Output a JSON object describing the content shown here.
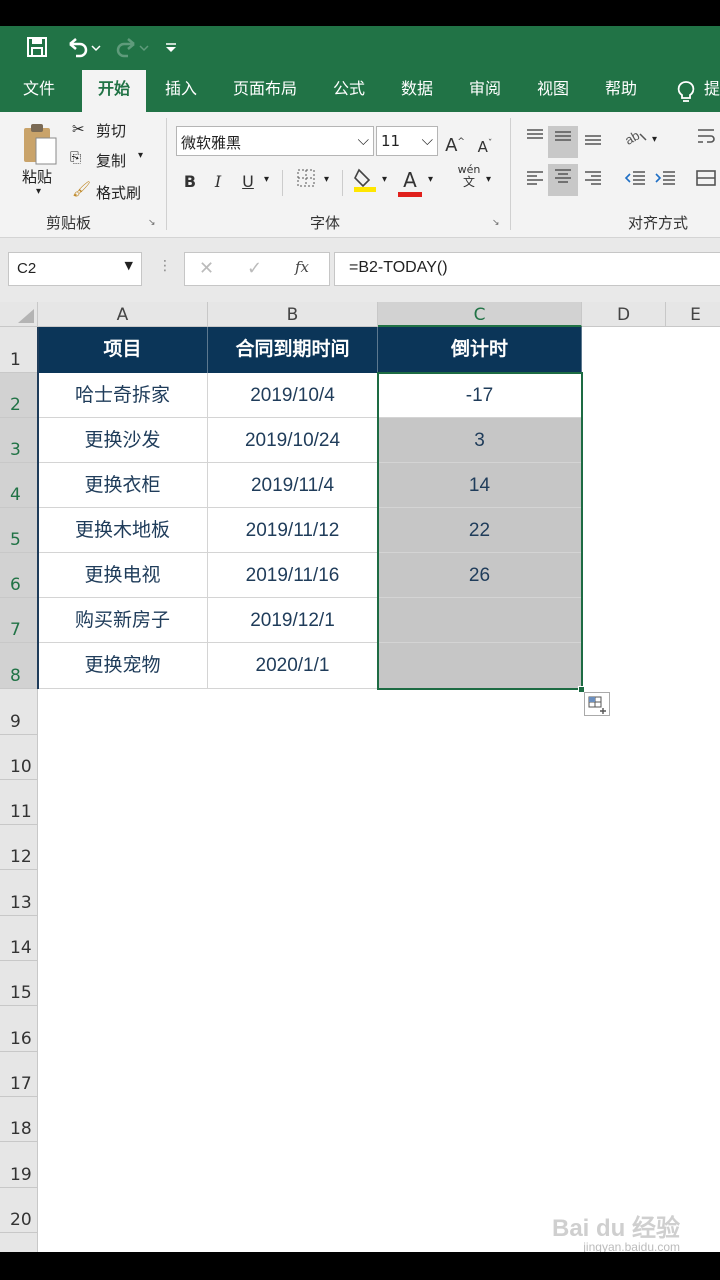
{
  "qat": {
    "save_icon": "save-icon",
    "undo_icon": "undo-icon",
    "redo_icon": "redo-icon",
    "customize_icon": "customize-icon"
  },
  "tabs": [
    {
      "label": "文件"
    },
    {
      "label": "开始"
    },
    {
      "label": "插入"
    },
    {
      "label": "页面布局"
    },
    {
      "label": "公式"
    },
    {
      "label": "数据"
    },
    {
      "label": "审阅"
    },
    {
      "label": "视图"
    },
    {
      "label": "帮助"
    },
    {
      "label": "提"
    }
  ],
  "ribbon": {
    "paste": "粘贴",
    "cut": "剪切",
    "copy": "复制",
    "format_painter": "格式刷",
    "clipboard_group": "剪贴板",
    "font_name": "微软雅黑",
    "font_size": "11",
    "bold": "B",
    "italic": "I",
    "underline": "U",
    "font_group": "字体",
    "phonetic": "wén",
    "phonetic_sub": "文",
    "align_group": "对齐方式",
    "grow_font": "A",
    "shrink_font": "A",
    "font_color_letter": "A"
  },
  "formula_bar": {
    "name_box": "C2",
    "formula": "=B2-TODAY()",
    "fx": "fx"
  },
  "columns": [
    "A",
    "B",
    "C",
    "D",
    "E"
  ],
  "rows": [
    "1",
    "2",
    "3",
    "4",
    "5",
    "6",
    "7",
    "8",
    "9",
    "10",
    "11",
    "12",
    "13",
    "14",
    "15",
    "16",
    "17",
    "18",
    "19",
    "20"
  ],
  "table": {
    "headers": [
      "项目",
      "合同到期时间",
      "倒计时"
    ],
    "rows": [
      {
        "item": "哈士奇拆家",
        "date": "2019/10/4",
        "countdown": "-17"
      },
      {
        "item": "更换沙发",
        "date": "2019/10/24",
        "countdown": "3"
      },
      {
        "item": "更换衣柜",
        "date": "2019/11/4",
        "countdown": "14"
      },
      {
        "item": "更换木地板",
        "date": "2019/11/12",
        "countdown": "22"
      },
      {
        "item": "更换电视",
        "date": "2019/11/16",
        "countdown": "26"
      },
      {
        "item": "购买新房子",
        "date": "2019/12/1",
        "countdown": ""
      },
      {
        "item": "更换宠物",
        "date": "2020/1/1",
        "countdown": ""
      }
    ]
  },
  "watermark": {
    "brand": "Bai du 经验",
    "url": "jingyan.baidu.com"
  },
  "colors": {
    "excel_green": "#217346",
    "header_navy": "#0b3558",
    "selection_gray": "#c6c6c6"
  }
}
